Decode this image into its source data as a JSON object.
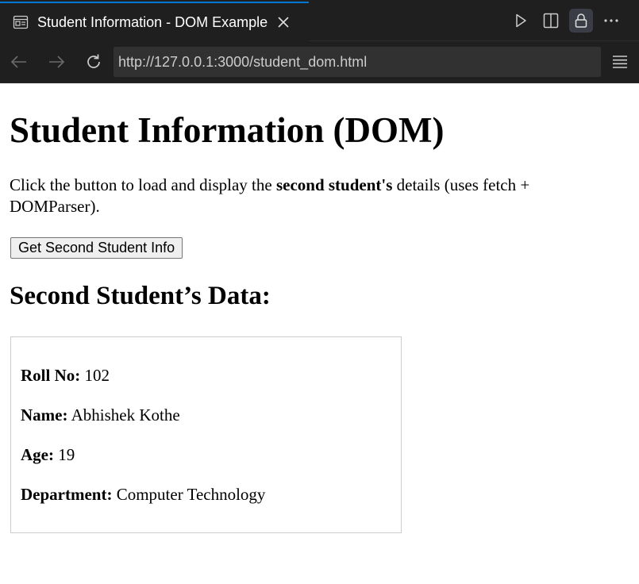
{
  "tab": {
    "title": "Student Information - DOM Example",
    "icon": "preview-icon"
  },
  "toolbar": {
    "icons": [
      "run-icon",
      "split-editor-icon",
      "lock-icon",
      "more-icon"
    ]
  },
  "browser": {
    "url": "http://127.0.0.1:3000/student_dom.html",
    "icons": [
      "back-arrow-icon",
      "forward-arrow-icon",
      "reload-icon",
      "menu-icon"
    ]
  },
  "page": {
    "title": "Student Information (DOM)",
    "intro_before": "Click the button to load and display the ",
    "intro_bold": "second student's",
    "intro_after": " details (uses fetch + DOMParser).",
    "button_label": "Get Second Student Info",
    "section_title": "Second Student’s Data:",
    "student": {
      "roll_label": "Roll No:",
      "roll_value": " 102",
      "name_label": "Name:",
      "name_value": " Abhishek Kothe",
      "age_label": "Age:",
      "age_value": " 19",
      "dept_label": "Department:",
      "dept_value": " Computer Technology"
    }
  },
  "colors": {
    "chrome_bg": "#1f1f1f",
    "accent": "#0078d4",
    "url_bg": "#313131"
  }
}
